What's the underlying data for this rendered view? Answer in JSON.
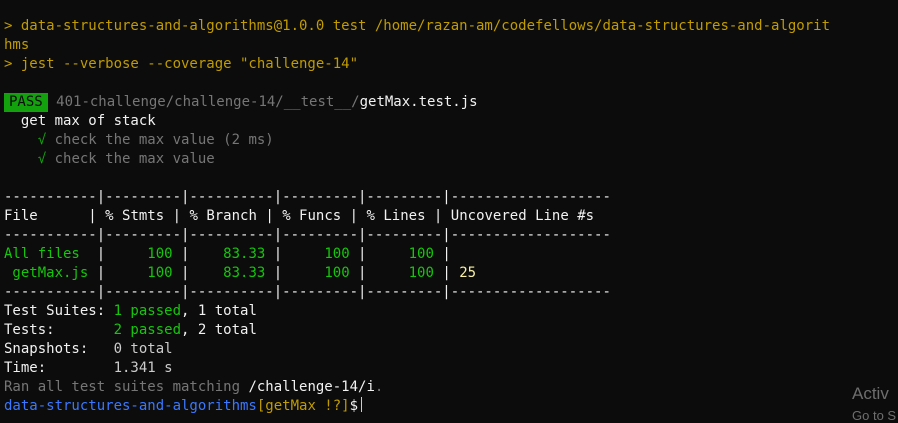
{
  "run": {
    "line1": "> data-structures-and-algorithms@1.0.0 test /home/razan-am/codefellows/data-structures-and-algorit",
    "line1_wrap": "hms",
    "line2": "> jest --verbose --coverage \"challenge-14\""
  },
  "result": {
    "badge": "PASS",
    "path_dim": "401-challenge/challenge-14/__test__/",
    "file": "getMax.test.js",
    "describe": "get max of stack",
    "tests": [
      {
        "check": "√",
        "name": "check the max value (2 ms)"
      },
      {
        "check": "√",
        "name": "check the max value"
      }
    ]
  },
  "coverage": {
    "separator": "-----------|---------|----------|---------|---------|-------------------",
    "headers": {
      "file": "File      ",
      "stmts": " % Stmts ",
      "branch": " % Branch ",
      "funcs": " % Funcs ",
      "lines": " % Lines ",
      "uncovered": " Uncovered Line #s"
    },
    "rows": [
      {
        "file": "All files ",
        "stmts": "     100 ",
        "branch": "    83.33 ",
        "funcs": "     100 ",
        "lines": "     100 ",
        "uncovered": ""
      },
      {
        "file": " getMax.js",
        "stmts": "     100 ",
        "branch": "    83.33 ",
        "funcs": "     100 ",
        "lines": "     100 ",
        "uncovered": " 25"
      }
    ]
  },
  "summary": {
    "suites_label": "Test Suites: ",
    "suites_pass": "1 passed",
    "suites_rest": ", 1 total",
    "tests_label": "Tests:       ",
    "tests_pass": "2 passed",
    "tests_rest": ", 2 total",
    "snap_label": "Snapshots:   ",
    "snap_val": "0 total",
    "time_label": "Time:        ",
    "time_val": "1.341 s",
    "ran_prefix": "Ran all test suites matching ",
    "ran_pattern": "/challenge-14/i",
    "ran_suffix": "."
  },
  "prompt": {
    "repo": "data-structures-and-algorithms",
    "branch": "[getMax !?]",
    "symbol": "$"
  },
  "watermark": {
    "line1": "Activ",
    "line2": "Go to S"
  }
}
